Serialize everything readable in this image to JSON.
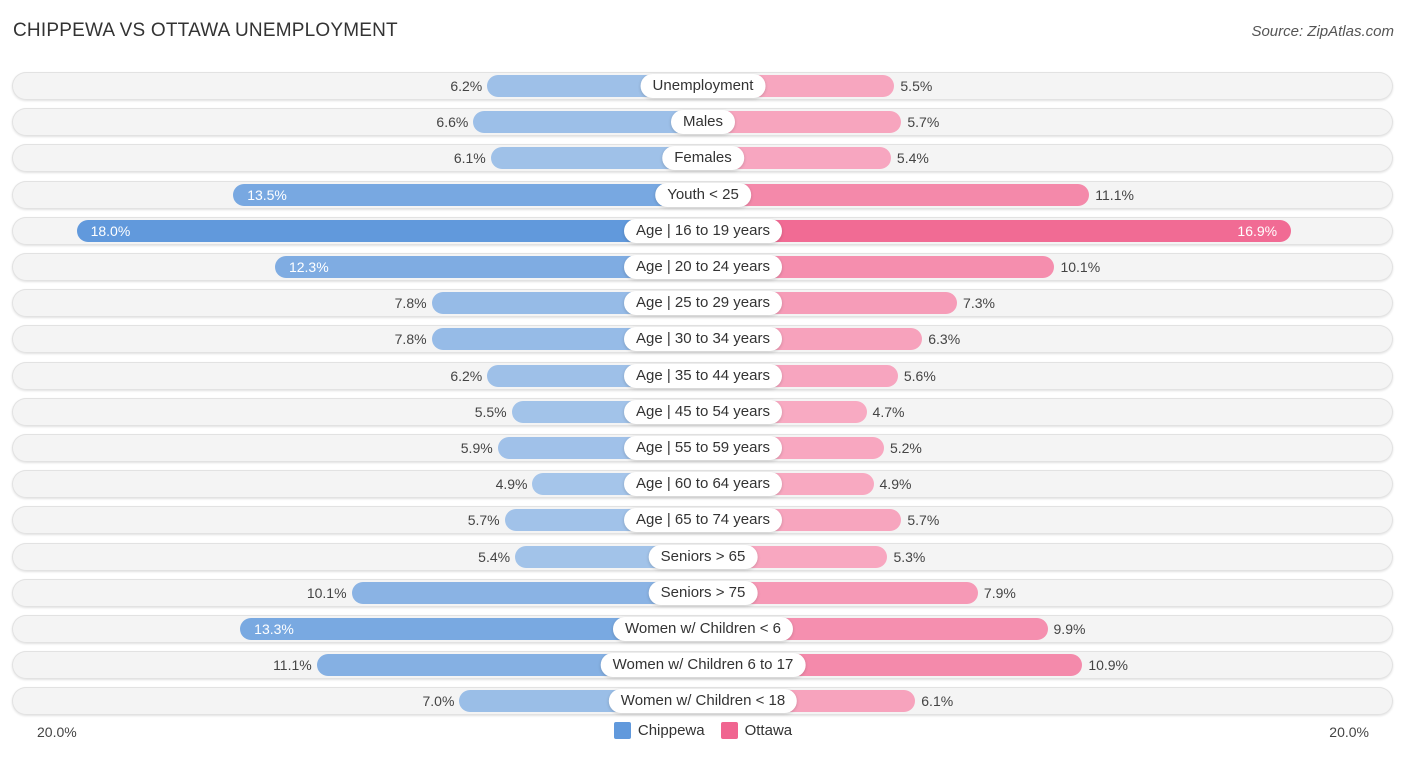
{
  "header": {
    "title": "CHIPPEWA VS OTTAWA UNEMPLOYMENT",
    "source": "Source: ZipAtlas.com"
  },
  "colors": {
    "chippewa_light": "#a7c6ea",
    "chippewa_dark": "#6199dc",
    "ottawa_light": "#f8abc3",
    "ottawa_dark": "#f06590"
  },
  "chart_data": {
    "type": "bar",
    "orientation": "horizontal-diverging",
    "title": "CHIPPEWA VS OTTAWA UNEMPLOYMENT",
    "xlabel": "",
    "ylabel": "",
    "xlim": [
      -20.0,
      20.0
    ],
    "axis_labels": {
      "left": "20.0%",
      "right": "20.0%"
    },
    "legend_position": "bottom-center",
    "categories": [
      "Unemployment",
      "Males",
      "Females",
      "Youth < 25",
      "Age | 16 to 19 years",
      "Age | 20 to 24 years",
      "Age | 25 to 29 years",
      "Age | 30 to 34 years",
      "Age | 35 to 44 years",
      "Age | 45 to 54 years",
      "Age | 55 to 59 years",
      "Age | 60 to 64 years",
      "Age | 65 to 74 years",
      "Seniors > 65",
      "Seniors > 75",
      "Women w/ Children < 6",
      "Women w/ Children 6 to 17",
      "Women w/ Children < 18"
    ],
    "series": [
      {
        "name": "Chippewa",
        "side": "left",
        "values": [
          6.2,
          6.6,
          6.1,
          13.5,
          18.0,
          12.3,
          7.8,
          7.8,
          6.2,
          5.5,
          5.9,
          4.9,
          5.7,
          5.4,
          10.1,
          13.3,
          11.1,
          7.0
        ],
        "labels": [
          "6.2%",
          "6.6%",
          "6.1%",
          "13.5%",
          "18.0%",
          "12.3%",
          "7.8%",
          "7.8%",
          "6.2%",
          "5.5%",
          "5.9%",
          "4.9%",
          "5.7%",
          "5.4%",
          "10.1%",
          "13.3%",
          "11.1%",
          "7.0%"
        ]
      },
      {
        "name": "Ottawa",
        "side": "right",
        "values": [
          5.5,
          5.7,
          5.4,
          11.1,
          16.9,
          10.1,
          7.3,
          6.3,
          5.6,
          4.7,
          5.2,
          4.9,
          5.7,
          5.3,
          7.9,
          9.9,
          10.9,
          6.1
        ],
        "labels": [
          "5.5%",
          "5.7%",
          "5.4%",
          "11.1%",
          "16.9%",
          "10.1%",
          "7.3%",
          "6.3%",
          "5.6%",
          "4.7%",
          "5.2%",
          "4.9%",
          "5.7%",
          "5.3%",
          "7.9%",
          "9.9%",
          "10.9%",
          "6.1%"
        ]
      }
    ]
  },
  "legend": {
    "items": [
      {
        "label": "Chippewa"
      },
      {
        "label": "Ottawa"
      }
    ]
  }
}
